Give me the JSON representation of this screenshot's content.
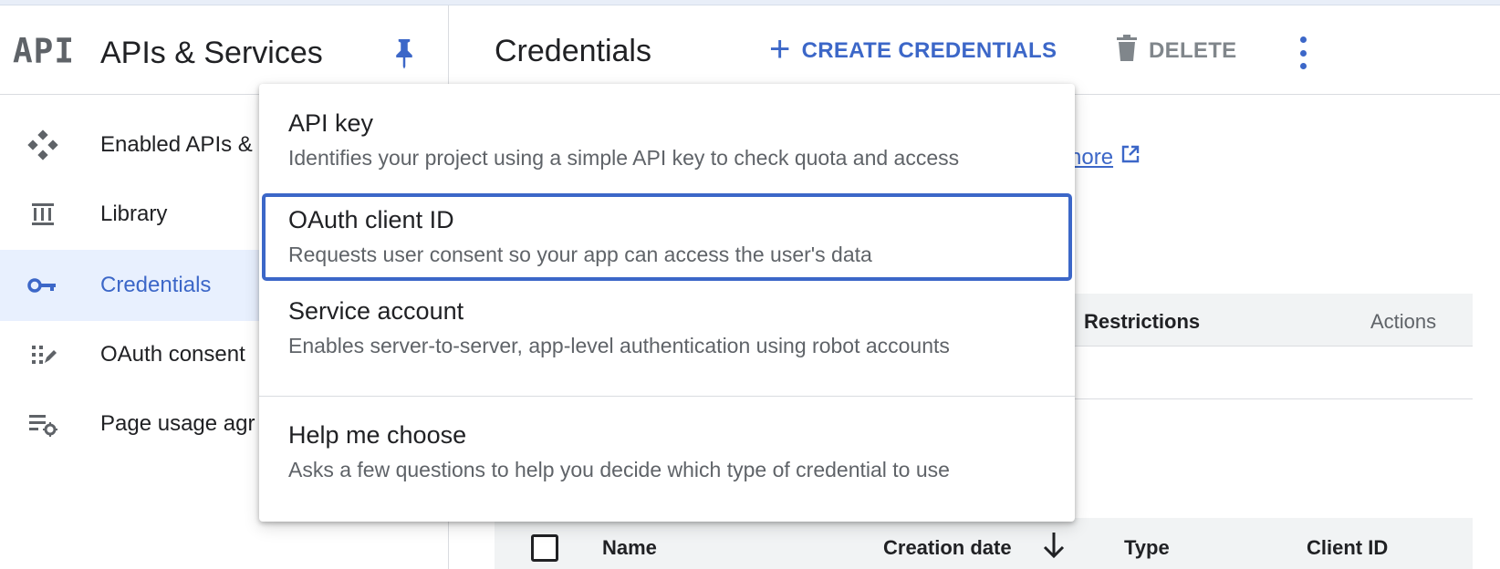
{
  "sidebar": {
    "logo_text": "API",
    "title": "APIs & Services",
    "items": [
      {
        "label": "Enabled APIs &",
        "icon": "diamond-grid-icon"
      },
      {
        "label": "Library",
        "icon": "library-icon"
      },
      {
        "label": "Credentials",
        "icon": "key-icon",
        "active": true
      },
      {
        "label": "OAuth consent",
        "icon": "consent-icon"
      },
      {
        "label": "Page usage agr",
        "icon": "settings-list-icon"
      }
    ]
  },
  "header": {
    "title": "Credentials",
    "create_label": "CREATE CREDENTIALS",
    "delete_label": "DELETE"
  },
  "content": {
    "learn_more_partial": "nore",
    "table1": {
      "restrictions": "Restrictions",
      "actions": "Actions"
    },
    "table2": {
      "name": "Name",
      "creation_date": "Creation date",
      "type": "Type",
      "client_id": "Client ID"
    }
  },
  "menu": {
    "items": [
      {
        "title": "API key",
        "desc": "Identifies your project using a simple API key to check quota and access"
      },
      {
        "title": "OAuth client ID",
        "desc": "Requests user consent so your app can access the user's data"
      },
      {
        "title": "Service account",
        "desc": "Enables server-to-server, app-level authentication using robot accounts"
      },
      {
        "title": "Help me choose",
        "desc": "Asks a few questions to help you decide which type of credential to use"
      }
    ]
  },
  "colors": {
    "accent": "#3c67c8",
    "active_bg": "#e8f0fe",
    "muted": "#5f6368"
  }
}
